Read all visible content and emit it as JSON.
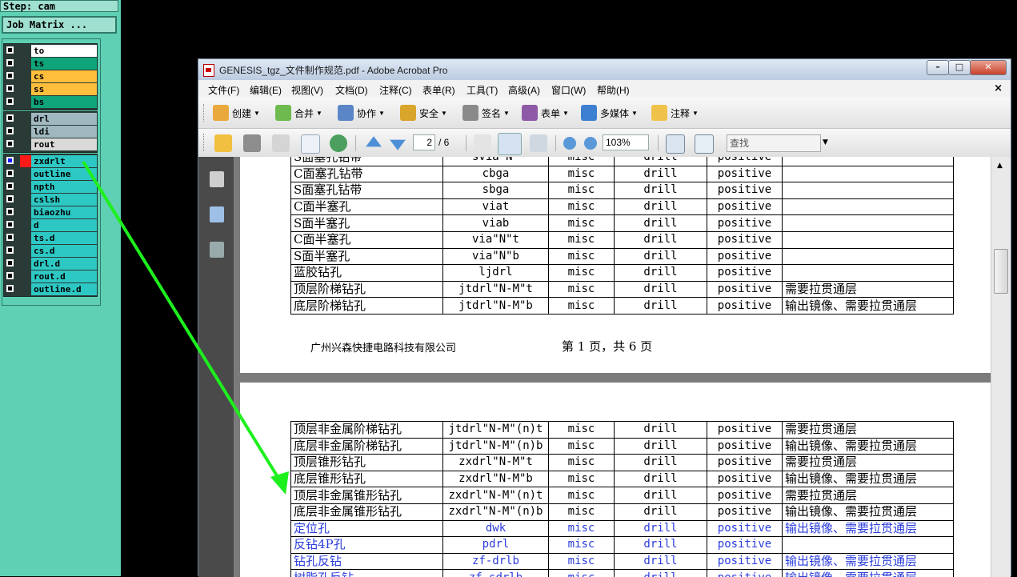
{
  "genesis": {
    "step_label": "Step: cam",
    "job_matrix_button": "Job Matrix ...",
    "layers": [
      {
        "name": "to",
        "color": "#ffffff"
      },
      {
        "name": "ts",
        "color": "#0fa47a"
      },
      {
        "name": "cs",
        "color": "#ffbf3c"
      },
      {
        "name": "ss",
        "color": "#ffbf3c"
      },
      {
        "name": "bs",
        "color": "#0fa47a"
      },
      {
        "name": "drl",
        "color": "#9fb8c0"
      },
      {
        "name": "ldi",
        "color": "#9fb8c0"
      },
      {
        "name": "rout",
        "color": "#d9d9d9"
      },
      {
        "name": "zxdrlt",
        "color": "#2ec8c4"
      },
      {
        "name": "outline",
        "color": "#2ec8c4"
      },
      {
        "name": "npth",
        "color": "#2ec8c4"
      },
      {
        "name": "cslsh",
        "color": "#2ec8c4"
      },
      {
        "name": "biaozhu",
        "color": "#2ec8c4"
      },
      {
        "name": "d",
        "color": "#2ec8c4"
      },
      {
        "name": "ts.d",
        "color": "#2ec8c4"
      },
      {
        "name": "cs.d",
        "color": "#2ec8c4"
      },
      {
        "name": "drl.d",
        "color": "#2ec8c4"
      },
      {
        "name": "rout.d",
        "color": "#2ec8c4"
      },
      {
        "name": "outline.d",
        "color": "#2ec8c4"
      }
    ]
  },
  "acrobat": {
    "title": "GENESIS_tgz_文件制作规范.pdf - Adobe Acrobat Pro",
    "menus": [
      "文件(F)",
      "编辑(E)",
      "视图(V)",
      "文档(D)",
      "注释(C)",
      "表单(R)",
      "工具(T)",
      "高级(A)",
      "窗口(W)",
      "帮助(H)"
    ],
    "task_buttons": [
      "创建",
      "合并",
      "协作",
      "安全",
      "签名",
      "表单",
      "多媒体",
      "注释"
    ],
    "page_current": "2",
    "page_total": "/ 6",
    "zoom": "103%",
    "search_placeholder": "查找",
    "page1_rows": [
      [
        "S面塞孔钻带",
        "svia\"N\"",
        "misc",
        "drill",
        "positive",
        ""
      ],
      [
        "C面塞孔钻带",
        "cbga",
        "misc",
        "drill",
        "positive",
        ""
      ],
      [
        "S面塞孔钻带",
        "sbga",
        "misc",
        "drill",
        "positive",
        ""
      ],
      [
        "C面半塞孔",
        "viat",
        "misc",
        "drill",
        "positive",
        ""
      ],
      [
        "S面半塞孔",
        "viab",
        "misc",
        "drill",
        "positive",
        ""
      ],
      [
        "C面半塞孔",
        "via\"N\"t",
        "misc",
        "drill",
        "positive",
        ""
      ],
      [
        "S面半塞孔",
        "via\"N\"b",
        "misc",
        "drill",
        "positive",
        ""
      ],
      [
        "蓝胶钻孔",
        "ljdrl",
        "misc",
        "drill",
        "positive",
        ""
      ],
      [
        "顶层阶梯钻孔",
        "jtdrl\"N-M\"t",
        "misc",
        "drill",
        "positive",
        "需要拉贯通层"
      ],
      [
        "底层阶梯钻孔",
        "jtdrl\"N-M\"b",
        "misc",
        "drill",
        "positive",
        "输出镜像、需要拉贯通层"
      ]
    ],
    "footer_company": "广州兴森快捷电路科技有限公司",
    "footer_page": "第 1 页，共 6 页",
    "page2_rows": [
      [
        "顶层非金属阶梯钻孔",
        "jtdrl\"N-M\"(n)t",
        "misc",
        "drill",
        "positive",
        "需要拉贯通层"
      ],
      [
        "底层非金属阶梯钻孔",
        "jtdrl\"N-M\"(n)b",
        "misc",
        "drill",
        "positive",
        "输出镜像、需要拉贯通层"
      ],
      [
        "顶层锥形钻孔",
        "zxdrl\"N-M\"t",
        "misc",
        "drill",
        "positive",
        "需要拉贯通层"
      ],
      [
        "底层锥形钻孔",
        "zxdrl\"N-M\"b",
        "misc",
        "drill",
        "positive",
        "输出镜像、需要拉贯通层"
      ],
      [
        "顶层非金属锥形钻孔",
        "zxdrl\"N-M\"(n)t",
        "misc",
        "drill",
        "positive",
        "需要拉贯通层"
      ],
      [
        "底层非金属锥形钻孔",
        "zxdrl\"N-M\"(n)b",
        "misc",
        "drill",
        "positive",
        "输出镜像、需要拉贯通层"
      ],
      [
        "定位孔",
        "dwk",
        "misc",
        "drill",
        "positive",
        "输出镜像、需要拉贯通层"
      ],
      [
        "反钻4P孔",
        "pdrl",
        "misc",
        "drill",
        "positive",
        ""
      ],
      [
        "钻孔反钻",
        "zf-drlb",
        "misc",
        "drill",
        "positive",
        "输出镜像、需要拉贯通层"
      ],
      [
        "树脂孔反钻",
        "zf-sdrlb",
        "misc",
        "drill",
        "positive",
        "输出镜像、需要拉贯通层"
      ]
    ],
    "page2_blue_from": 6
  }
}
